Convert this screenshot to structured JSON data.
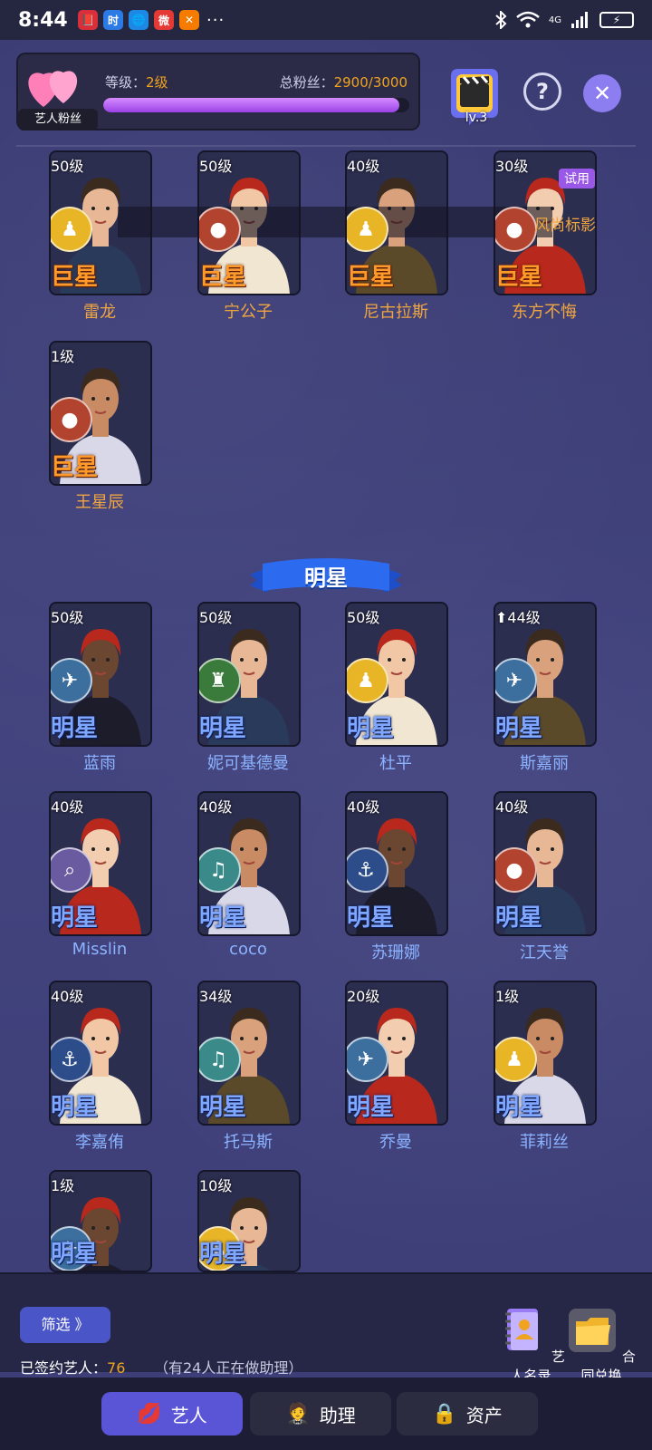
{
  "statusbar": {
    "time": "8:44",
    "apps": [
      "📕",
      "时",
      "🌐",
      "微",
      "✕"
    ],
    "dots": "···",
    "network": "4G",
    "icons": [
      "bluetooth-icon",
      "wifi-icon",
      "signal-icon",
      "battery-icon"
    ]
  },
  "header": {
    "fans_tag": "艺人粉丝",
    "level_label": "等级：",
    "level_value": "2级",
    "fans_label": "总粉丝：",
    "fans_value": "2900/3000",
    "progress_fraction": 0.967,
    "studio_level": "lv.3",
    "help_symbol": "?",
    "close_symbol": "✕"
  },
  "superstars": [
    {
      "level": "50级",
      "rank": "巨星",
      "name": "雷龙",
      "badge": "soldier",
      "trial": ""
    },
    {
      "level": "50级",
      "rank": "巨星",
      "name": "宁公子",
      "badge": "silhouette",
      "trial": ""
    },
    {
      "level": "40级",
      "rank": "巨星",
      "name": "尼古拉斯",
      "badge": "soldier",
      "trial": ""
    },
    {
      "level": "30级",
      "rank": "巨星",
      "name": "东方不悔",
      "badge": "silhouette",
      "trial": "试用"
    },
    {
      "level": "1级",
      "rank": "巨星",
      "name": "王星辰",
      "badge": "silhouette",
      "trial": ""
    }
  ],
  "overlay_text": "风尚标影",
  "section_star": "明星",
  "stars": [
    {
      "level": "50级",
      "rank": "明星",
      "name": "蓝雨",
      "badge": "ufo"
    },
    {
      "level": "50级",
      "rank": "明星",
      "name": "妮可基德曼",
      "badge": "liberty"
    },
    {
      "level": "50级",
      "rank": "明星",
      "name": "杜平",
      "badge": "soldier"
    },
    {
      "level": "44级",
      "rank": "明星",
      "name": "斯嘉丽",
      "badge": "ufo",
      "up": "⬆"
    },
    {
      "level": "40级",
      "rank": "明星",
      "name": "Misslin",
      "badge": "magnifier"
    },
    {
      "level": "40级",
      "rank": "明星",
      "name": "coco",
      "badge": "dance"
    },
    {
      "level": "40级",
      "rank": "明星",
      "name": "苏珊娜",
      "badge": "ship"
    },
    {
      "level": "40级",
      "rank": "明星",
      "name": "江天誉",
      "badge": "silhouette"
    },
    {
      "level": "40级",
      "rank": "明星",
      "name": "李嘉侑",
      "badge": "ship"
    },
    {
      "level": "34级",
      "rank": "明星",
      "name": "托马斯",
      "badge": "dance"
    },
    {
      "level": "20级",
      "rank": "明星",
      "name": "乔曼",
      "badge": "ufo"
    },
    {
      "level": "1级",
      "rank": "明星",
      "name": "菲莉丝",
      "badge": "soldier"
    },
    {
      "level": "1级",
      "rank": "明星",
      "name": "",
      "badge": "ufo"
    },
    {
      "level": "10级",
      "rank": "明星",
      "name": "",
      "badge": "soldier"
    }
  ],
  "bottom": {
    "filter_label": "筛选 》",
    "signed_label": "已签约艺人：",
    "signed_count": "76",
    "assisting_text": "（有24人正在做助理）",
    "directory_label": "艺人名录",
    "contract_label": "合同兑换"
  },
  "tabs": [
    {
      "label": "艺人",
      "icon": "💋",
      "active": true
    },
    {
      "label": "助理",
      "icon": "🤵",
      "active": false
    },
    {
      "label": "资产",
      "icon": "🔒",
      "active": false
    }
  ],
  "colors": {
    "background": "#3e3f78",
    "accent_gold": "#f0a31e",
    "superstar_rank": "#ff9a2a",
    "star_rank": "#7fa7ff",
    "progress": "#b065f0",
    "active_tab": "#5a55d6"
  }
}
